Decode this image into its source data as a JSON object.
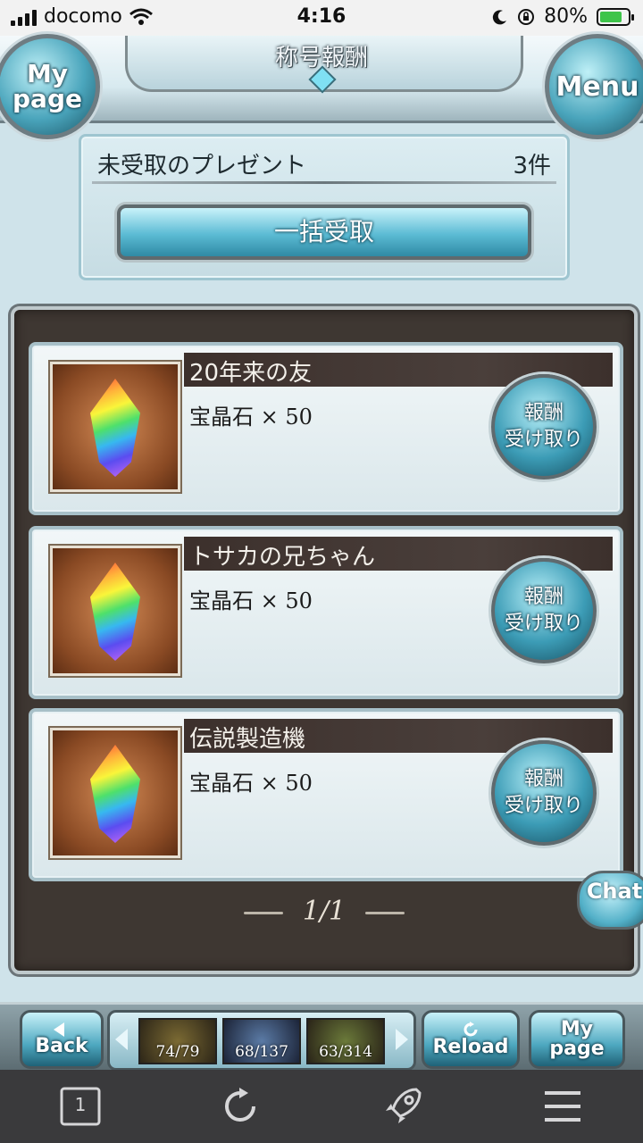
{
  "status_bar": {
    "carrier": "docomo",
    "time": "4:16",
    "battery": "80%"
  },
  "header": {
    "title": "称号報酬",
    "mypage_label": "My page",
    "menu_label": "Menu"
  },
  "present": {
    "label": "未受取のプレゼント",
    "count": "3件",
    "bulk_receive_label": "一括受取"
  },
  "rewards": [
    {
      "title": "20年来の友",
      "reward": "宝晶石 × 50",
      "button_line1": "報酬",
      "button_line2": "受け取り",
      "icon": "crystal-icon"
    },
    {
      "title": "トサカの兄ちゃん",
      "reward": "宝晶石 × 50",
      "button_line1": "報酬",
      "button_line2": "受け取り",
      "icon": "crystal-icon"
    },
    {
      "title": "伝説製造機",
      "reward": "宝晶石 × 50",
      "button_line1": "報酬",
      "button_line2": "受け取り",
      "icon": "crystal-icon"
    }
  ],
  "pagination": "1/1",
  "chat_label": "Chat",
  "gamebar": {
    "back_label": "Back",
    "reload_label": "Reload",
    "mypage_label": "My page",
    "stats": [
      "74/79",
      "68/137",
      "63/314"
    ]
  },
  "browser_toolbar": {
    "tabs_count": "1"
  },
  "colors": {
    "accent": "#4aa5bc",
    "panel": "#3e3732",
    "card": "#e7f0f3"
  }
}
